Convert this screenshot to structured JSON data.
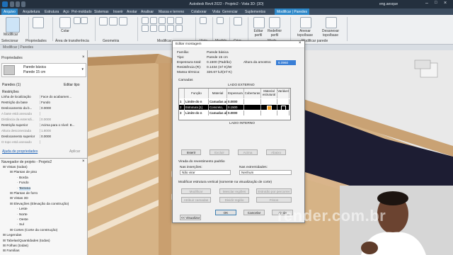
{
  "titlebar": {
    "title": "Autodesk Revit 2022 - Projeto2 - Vista 3D: {3D}",
    "user": "eng.aesque"
  },
  "menu": {
    "tabs": [
      "Arquivo",
      "Arquitetura",
      "Estrutura",
      "Aço",
      "Pré-moldado",
      "Sistemas",
      "Inserir",
      "Anotar",
      "Analisar",
      "Massa e terreno",
      "Colaborar",
      "Vista",
      "Gerenciar",
      "Suplementos",
      "Modificar | Paredes"
    ]
  },
  "ribbon": {
    "panels": [
      "Selecionar",
      "Propriedades",
      "Área de transferência",
      "Geometria",
      "Modificar",
      "Vista",
      "Medida",
      "Criar",
      "Modo",
      "Modificar parede"
    ],
    "buttons": [
      "Modificar",
      "Colar",
      "Editar perfil",
      "Redefinir perfil",
      "Anexar topo/base",
      "Desanexar topo/base"
    ],
    "context": "Modificar | Paredes"
  },
  "properties": {
    "title": "Propriedades",
    "type_family": "Parede básica",
    "type_name": "Parede 15 cm",
    "filter": "Paredes (1)",
    "edit_type": "Editar tipo",
    "section": "Restrições",
    "rows": [
      {
        "k": "Linha de localização",
        "v": "Face do acabamen..."
      },
      {
        "k": "Restrição da base",
        "v": "Fundo"
      },
      {
        "k": "Deslocamento da b...",
        "v": "0.0000"
      },
      {
        "k": "A base está anexada",
        "v": ""
      },
      {
        "k": "Distância da extensã...",
        "v": "0.0000"
      },
      {
        "k": "Restrição superior",
        "v": "Acima para o nível: B..."
      },
      {
        "k": "Altura desconectada",
        "v": "1.8000"
      },
      {
        "k": "Deslocamento superior",
        "v": "0.0000"
      },
      {
        "k": "O topo está anexado",
        "v": ""
      }
    ],
    "help_link": "Ajuda de propriedades",
    "apply": "Aplicar"
  },
  "browser": {
    "title": "Navegador de projeto - Projeto2",
    "items": [
      {
        "label": "Vistas (todas)",
        "level": 0
      },
      {
        "label": "Plantas de piso",
        "level": 1
      },
      {
        "label": "Borda",
        "level": 2
      },
      {
        "label": "Fundo",
        "level": 2
      },
      {
        "label": "Terreno",
        "level": 2
      },
      {
        "label": "Plantas de forro",
        "level": 1
      },
      {
        "label": "Vistas 3D",
        "level": 1
      },
      {
        "label": "Elevações (Elevação da construção)",
        "level": 1
      },
      {
        "label": "Leste",
        "level": 2
      },
      {
        "label": "Norte",
        "level": 2
      },
      {
        "label": "Oeste",
        "level": 2
      },
      {
        "label": "Sul",
        "level": 2
      },
      {
        "label": "Cortes (Corte da construção)",
        "level": 1
      },
      {
        "label": "Legendas",
        "level": 0
      },
      {
        "label": "Tabelas/Quantidades (todas)",
        "level": 0
      },
      {
        "label": "Folhas (todas)",
        "level": 0
      },
      {
        "label": "Famílias",
        "level": 0
      }
    ]
  },
  "dialog": {
    "title": "Editar montagem",
    "family_label": "Família:",
    "family_value": "Parede básica",
    "type_label": "Tipo:",
    "type_value": "Parede 15 cm",
    "thickness_label": "Espessura total:",
    "thickness_value": "0.1500 (Padrão)",
    "sample_height_label": "Altura da amostra:",
    "sample_height_value": "6.0960",
    "resistance_label": "Resistência (R):",
    "resistance_value": "0.1434 (m²·K)/W",
    "thermal_label": "Massa térmica:",
    "thermal_value": "326.67 kJ/(m²·K)",
    "layers_label": "Camadas",
    "exterior_side": "LADO EXTERNO",
    "interior_side": "LADO INTERNO",
    "columns": [
      "Função",
      "Material",
      "Espessura",
      "Coberturas",
      "Material estrutural",
      "Variável"
    ],
    "rows": [
      {
        "n": "1",
        "funcao": "Limite do n",
        "material": "Camadas ac",
        "espessura": "0.0000",
        "bold": true,
        "highlight": false
      },
      {
        "n": "2",
        "funcao": "Estrutura [1]",
        "material": "Concreto,",
        "espessura": "0.1500",
        "bold": false,
        "highlight": true
      },
      {
        "n": "3",
        "funcao": "Limite do n",
        "material": "Camadas ab",
        "espessura": "0.0000",
        "bold": true,
        "highlight": false
      }
    ],
    "layer_buttons": [
      "Inserir",
      "Excluir",
      "Acima",
      "Abaixo"
    ],
    "wrap_label": "Virada do revestimento padrão",
    "insert_label": "Nas inserções:",
    "insert_value": "Não virar",
    "ends_label": "Nas extremidades:",
    "ends_value": "Nenhum",
    "modify_label": "Modificar estrutura vertical (somente na visualização de corte)",
    "modify_buttons_row1": [
      "Modificar",
      "Mesclar regiões",
      "Estrutão por percorrer"
    ],
    "modify_buttons_row2": [
      "Atribuir camadas",
      "Dividir região",
      "Frisos"
    ],
    "preview": "<< Visualizar",
    "ok": "OK",
    "cancel": "Cancelar",
    "help": "Ajuda"
  },
  "watermark": "render.com.br",
  "colors": {
    "titlebar": "#24303e",
    "menubar": "#3d4d60",
    "active_tab": "#2d87c8",
    "wall_tan": "#d9b48a",
    "wall_dark": "#1b1b2e",
    "selected_row": "#000000"
  }
}
